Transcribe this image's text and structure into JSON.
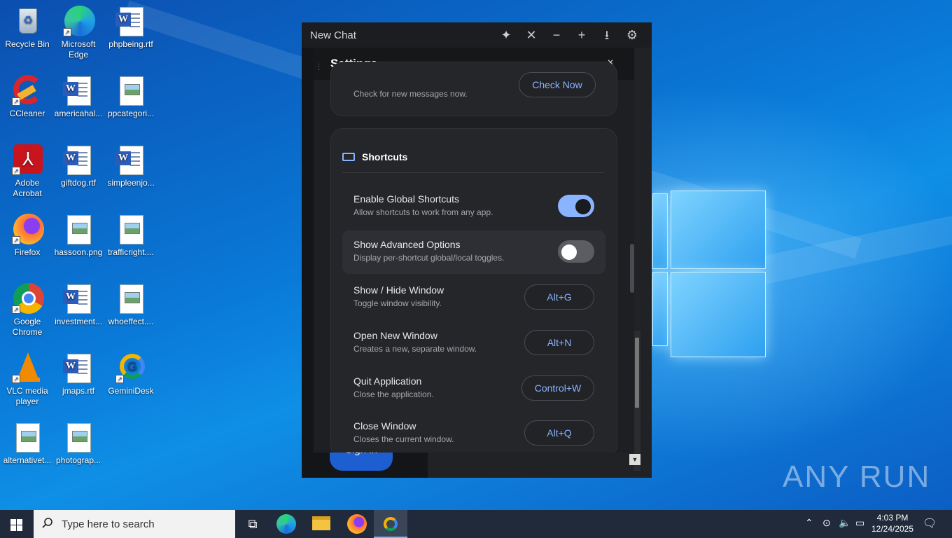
{
  "desktop": {
    "icons": [
      {
        "label": "Recycle Bin",
        "icon": "recycle-bin-icon"
      },
      {
        "label": "Microsoft Edge",
        "icon": "edge-icon"
      },
      {
        "label": "phpbeing.rtf",
        "icon": "word-doc-icon"
      },
      {
        "label": "CCleaner",
        "icon": "ccleaner-icon"
      },
      {
        "label": "americahal...",
        "icon": "word-doc-icon"
      },
      {
        "label": "ppcategori...",
        "icon": "image-file-icon"
      },
      {
        "label": "Adobe Acrobat",
        "icon": "acrobat-icon"
      },
      {
        "label": "giftdog.rtf",
        "icon": "word-doc-icon"
      },
      {
        "label": "simpleenjo...",
        "icon": "word-doc-icon"
      },
      {
        "label": "Firefox",
        "icon": "firefox-icon"
      },
      {
        "label": "hassoon.png",
        "icon": "image-file-icon"
      },
      {
        "label": "trafficright....",
        "icon": "image-file-icon"
      },
      {
        "label": "Google Chrome",
        "icon": "chrome-icon"
      },
      {
        "label": "investment...",
        "icon": "word-doc-icon"
      },
      {
        "label": "whoeffect....",
        "icon": "image-file-icon"
      },
      {
        "label": "VLC media player",
        "icon": "vlc-icon"
      },
      {
        "label": "jmaps.rtf",
        "icon": "word-doc-icon"
      },
      {
        "label": "GeminiDesk",
        "icon": "geminidesk-icon"
      },
      {
        "label": "alternativet...",
        "icon": "image-file-icon"
      },
      {
        "label": "photograp...",
        "icon": "image-file-icon"
      }
    ]
  },
  "app": {
    "window_title": "New Chat",
    "titlebar_buttons": [
      "sparkle-icon",
      "close-icon",
      "minimize-icon",
      "plus-icon",
      "download-icon",
      "gear-icon"
    ],
    "signin_label": "Sign in"
  },
  "settings": {
    "title": "Settings",
    "close_glyph": "×",
    "check_messages": {
      "subtitle": "Check for new messages now.",
      "button": "Check Now"
    },
    "shortcuts": {
      "heading": "Shortcuts",
      "enable_global": {
        "title": "Enable Global Shortcuts",
        "subtitle": "Allow shortcuts to work from any app.",
        "enabled": true
      },
      "show_advanced": {
        "title": "Show Advanced Options",
        "subtitle": "Display per-shortcut global/local toggles.",
        "enabled": false
      },
      "items": [
        {
          "title": "Show / Hide Window",
          "subtitle": "Toggle window visibility.",
          "key": "Alt+G"
        },
        {
          "title": "Open New Window",
          "subtitle": "Creates a new, separate window.",
          "key": "Alt+N"
        },
        {
          "title": "Quit Application",
          "subtitle": "Close the application.",
          "key": "Control+W"
        },
        {
          "title": "Close Window",
          "subtitle": "Closes the current window.",
          "key": "Alt+Q"
        }
      ]
    }
  },
  "watermark": "ANY RUN",
  "taskbar": {
    "search_placeholder": "Type here to search",
    "pinned": [
      "task-view-icon",
      "edge-icon",
      "file-explorer-icon",
      "firefox-icon",
      "geminidesk-icon"
    ],
    "time": "4:03 PM",
    "date": "12/24/2025"
  },
  "colors": {
    "accent": "#8ab4ff",
    "dialog_bg": "#1e1f22",
    "taskbar_bg": "#202a3a"
  }
}
